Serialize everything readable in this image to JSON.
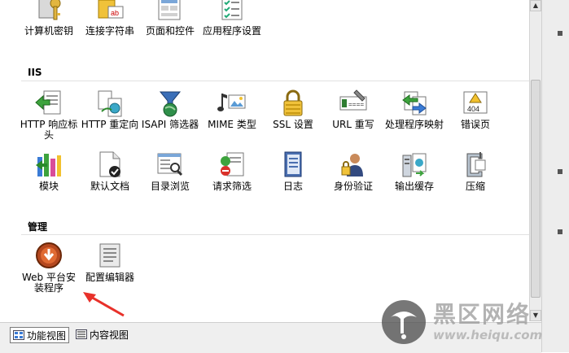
{
  "sections": {
    "top": {
      "items": [
        {
          "label": "计算机密钥",
          "icon": "key-icon"
        },
        {
          "label": "连接字符串",
          "icon": "connection-strings-icon"
        },
        {
          "label": "页面和控件",
          "icon": "pages-controls-icon"
        },
        {
          "label": "应用程序设置",
          "icon": "app-settings-icon"
        }
      ]
    },
    "iis": {
      "title": "IIS",
      "row1": [
        {
          "label": "HTTP 响应标头",
          "icon": "http-response-headers-icon"
        },
        {
          "label": "HTTP 重定向",
          "icon": "http-redirect-icon"
        },
        {
          "label": "ISAPI 筛选器",
          "icon": "isapi-filter-icon"
        },
        {
          "label": "MIME 类型",
          "icon": "mime-types-icon"
        },
        {
          "label": "SSL 设置",
          "icon": "lock-icon"
        },
        {
          "label": "URL 重写",
          "icon": "url-rewrite-icon"
        },
        {
          "label": "处理程序映射",
          "icon": "handler-mappings-icon"
        },
        {
          "label": "错误页",
          "icon": "error-page-icon"
        }
      ],
      "row2": [
        {
          "label": "模块",
          "icon": "modules-icon"
        },
        {
          "label": "默认文档",
          "icon": "default-document-icon"
        },
        {
          "label": "目录浏览",
          "icon": "directory-browsing-icon"
        },
        {
          "label": "请求筛选",
          "icon": "request-filtering-icon"
        },
        {
          "label": "日志",
          "icon": "logging-icon"
        },
        {
          "label": "身份验证",
          "icon": "authentication-icon"
        },
        {
          "label": "输出缓存",
          "icon": "output-caching-icon"
        },
        {
          "label": "压缩",
          "icon": "compression-icon"
        }
      ]
    },
    "management": {
      "title": "管理",
      "items": [
        {
          "label": "Web 平台安装程序",
          "icon": "web-platform-installer-icon"
        },
        {
          "label": "配置编辑器",
          "icon": "configuration-editor-icon"
        }
      ]
    }
  },
  "bottom_tabs": [
    {
      "label": "功能视图",
      "active": true
    },
    {
      "label": "内容视图",
      "active": false
    }
  ],
  "watermark": {
    "title": "黑区网络",
    "url": "www.heiqu.com"
  },
  "colors": {
    "arrow": "#e8312a",
    "section_line": "#e1e1e1"
  }
}
